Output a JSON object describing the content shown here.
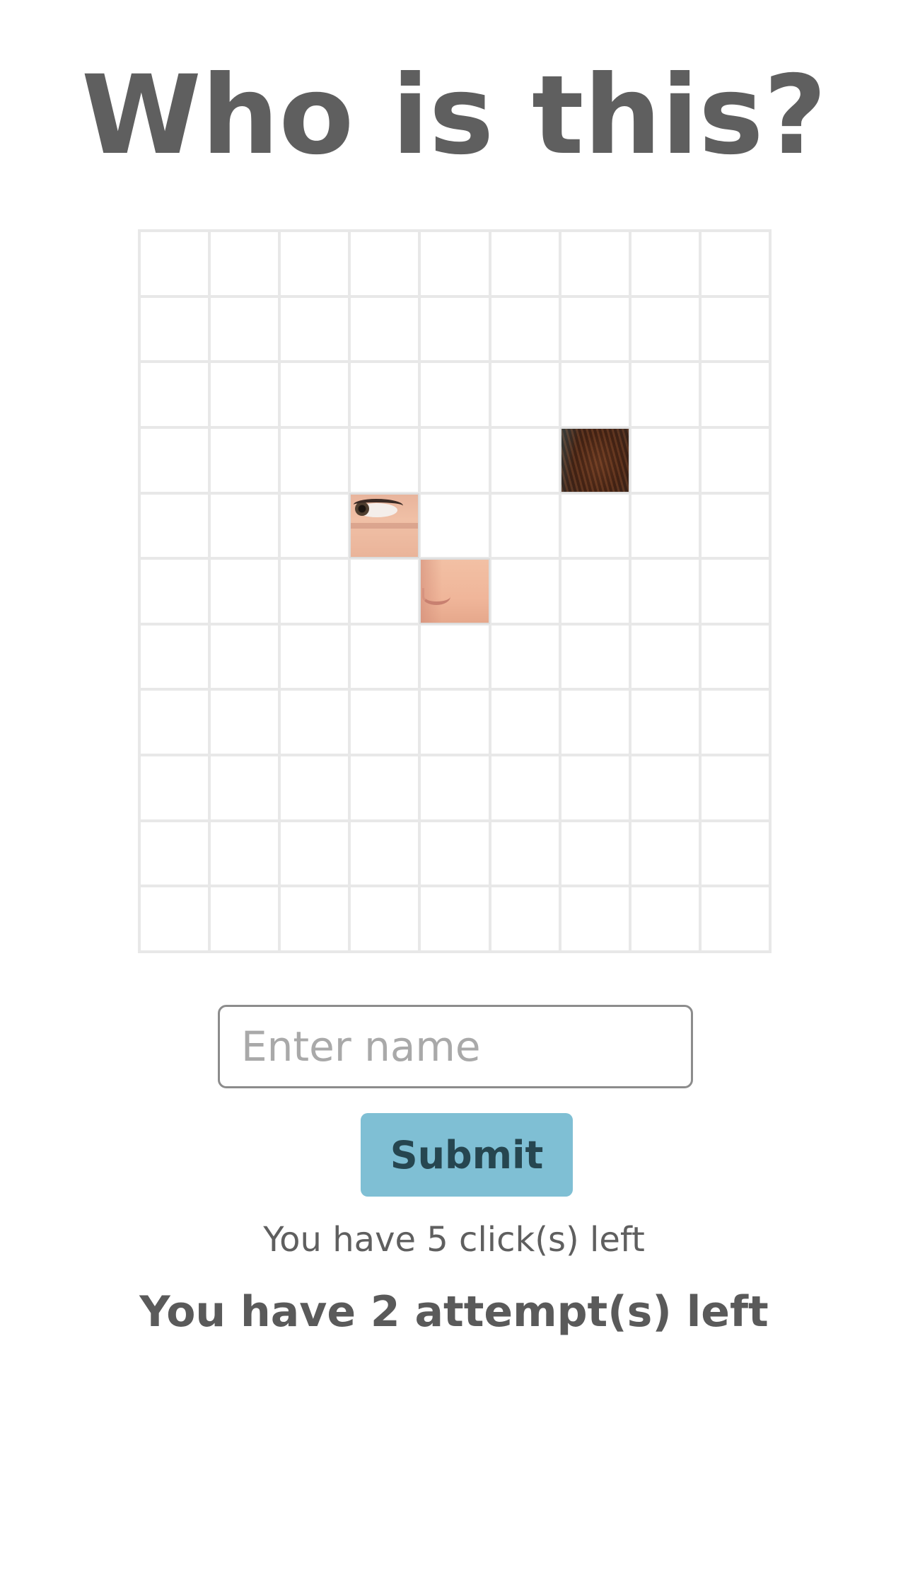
{
  "title": "Who is this?",
  "grid": {
    "columns": 9,
    "rows": 11,
    "revealed": [
      {
        "row": 3,
        "col": 6,
        "fragment": "hair"
      },
      {
        "row": 4,
        "col": 3,
        "fragment": "eye"
      },
      {
        "row": 5,
        "col": 4,
        "fragment": "nose"
      }
    ]
  },
  "form": {
    "name_placeholder": "Enter name",
    "name_value": "",
    "submit_label": "Submit"
  },
  "status": {
    "clicks_text": "You have 5 click(s) left",
    "attempts_text": "You have 2 attempt(s) left"
  },
  "colors": {
    "title": "#5f5f5f",
    "grid_line": "#e8e8e8",
    "submit_bg": "#7fbfd4",
    "submit_text": "#264650"
  }
}
